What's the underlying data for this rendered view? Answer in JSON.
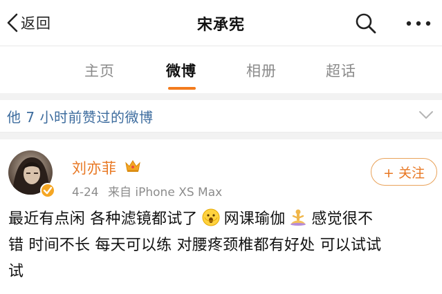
{
  "topbar": {
    "back_label": "返回",
    "title": "宋承宪"
  },
  "tabs": [
    {
      "label": "主页",
      "active": false
    },
    {
      "label": "微博",
      "active": true
    },
    {
      "label": "相册",
      "active": false
    },
    {
      "label": "超话",
      "active": false
    }
  ],
  "likes_row": {
    "text": "他 7 小时前赞过的微博"
  },
  "post": {
    "username": "刘亦菲",
    "date": "4-24",
    "source": "来自 iPhone XS Max",
    "follow_label": "+ 关注",
    "body_segments": [
      "最近有点闲 各种滤镜都试了",
      "网课瑜伽",
      "感觉很不",
      "错 时间不长 每天可以练 对腰疼颈椎都有好处 可以试试",
      "试"
    ],
    "emojis": [
      "surprised-face-emoji",
      "yoga-person-emoji"
    ]
  },
  "colors": {
    "accent": "#f37b1d",
    "username": "#e87722",
    "link_blue": "#3d6c9e",
    "muted": "#8c8c8c"
  }
}
